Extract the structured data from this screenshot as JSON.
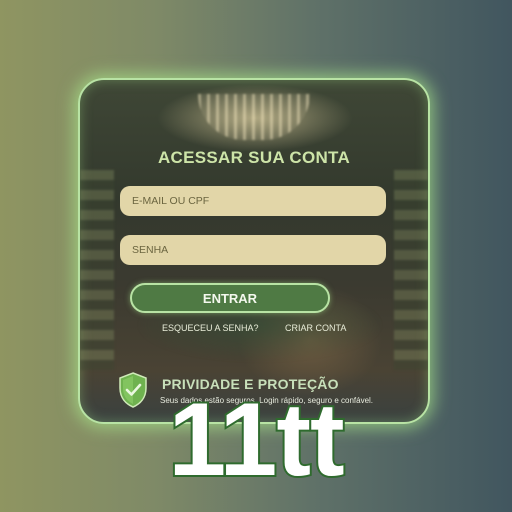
{
  "login_card": {
    "title": "ACESSAR SUA CONTA",
    "email_placeholder": "E-MAIL OU CPF",
    "password_placeholder": "SENHA",
    "enter_button_label": "ENTRAR",
    "forgot_password_link": "ESQUECEU A SENHA?",
    "create_account_link": "CRIAR CONTA"
  },
  "privacy": {
    "icon": "shield-check-icon",
    "title": "PRIVIDADE E PROTEÇÃO",
    "description": "Seus dados estão seguros. Login rápido, seguro e confável."
  },
  "brand_label": "11tt",
  "colors": {
    "accent_green": "#4f7a44",
    "glow_green": "#b8e3a4",
    "field_beige": "#e2d6a8",
    "title_green": "#cde4a8"
  }
}
